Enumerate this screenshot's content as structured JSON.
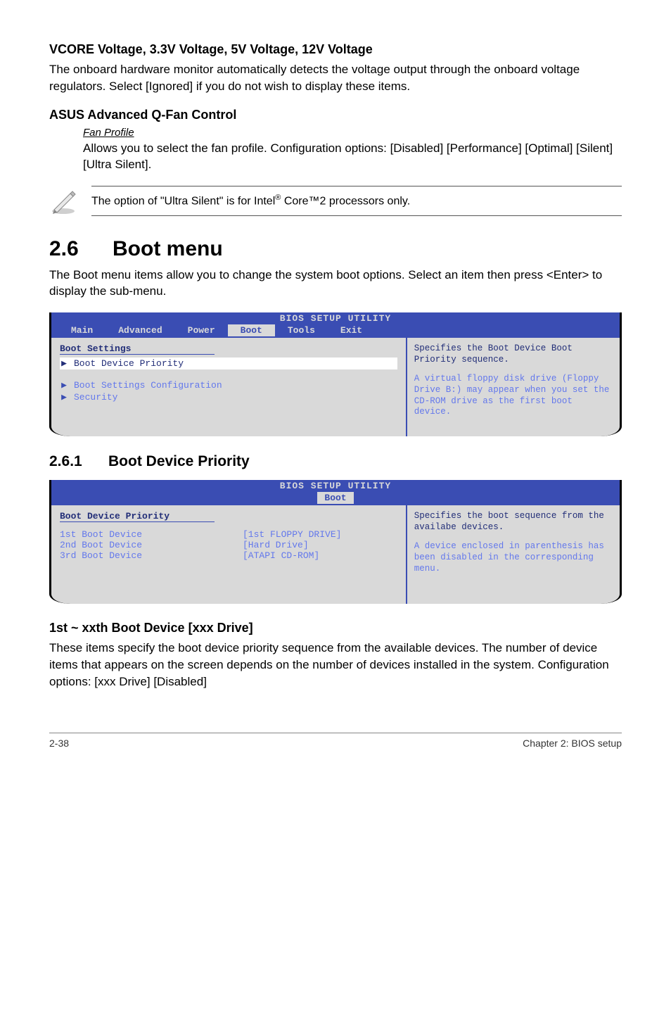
{
  "vcore": {
    "heading": "VCORE Voltage, 3.3V Voltage, 5V Voltage, 12V Voltage",
    "body": "The onboard hardware monitor automatically detects the voltage output through the onboard voltage regulators. Select [Ignored] if you do not wish to display these items."
  },
  "qfan": {
    "heading": "ASUS Advanced Q-Fan Control",
    "profile_label": "Fan Profile",
    "profile_text": "Allows you to select the fan profile. Configuration options: [Disabled] [Performance] [Optimal] [Silent] [Ultra Silent]."
  },
  "note": {
    "prefix": "The option of \"Ultra Silent\" is for Intel",
    "reg": "®",
    "suffix": " Core™2 processors only."
  },
  "boot_menu": {
    "num": "2.6",
    "title": "Boot menu",
    "intro": "The Boot menu items allow you to change the system boot options. Select an item then press <Enter> to display the sub-menu."
  },
  "bios1": {
    "title": "BIOS SETUP UTILITY",
    "tabs": [
      "Main",
      "Advanced",
      "Power",
      "Boot",
      "Tools",
      "Exit"
    ],
    "settings_label": "Boot Settings",
    "item_priority": "Boot Device Priority",
    "item_config": "Boot Settings Configuration",
    "item_security": "Security",
    "help_top": "Specifies the Boot Device Boot Priority sequence.",
    "help_bottom": "A virtual floppy disk drive (Floppy Drive B:) may appear when you set the CD-ROM drive as the first boot device."
  },
  "priority_section": {
    "num": "2.6.1",
    "title": "Boot Device Priority"
  },
  "bios2": {
    "title": "BIOS SETUP UTILITY",
    "tab": "Boot",
    "heading": "Boot Device Priority",
    "rows": [
      {
        "k": "1st Boot Device",
        "v": "[1st FLOPPY DRIVE]"
      },
      {
        "k": "2nd Boot Device",
        "v": "[Hard Drive]"
      },
      {
        "k": "3rd Boot Device",
        "v": "[ATAPI CD-ROM]"
      }
    ],
    "help_top": "Specifies the boot sequence from the availabe devices.",
    "help_bottom": "A device enclosed in parenthesis has been disabled in the corresponding menu."
  },
  "xxth": {
    "heading": "1st ~ xxth Boot Device [xxx Drive]",
    "body": "These items specify the boot device priority sequence from the available devices. The number of device items that appears on the screen depends on the number of devices installed in the system. Configuration options: [xxx Drive] [Disabled]"
  },
  "footer": {
    "left": "2-38",
    "right": "Chapter 2: BIOS setup"
  }
}
